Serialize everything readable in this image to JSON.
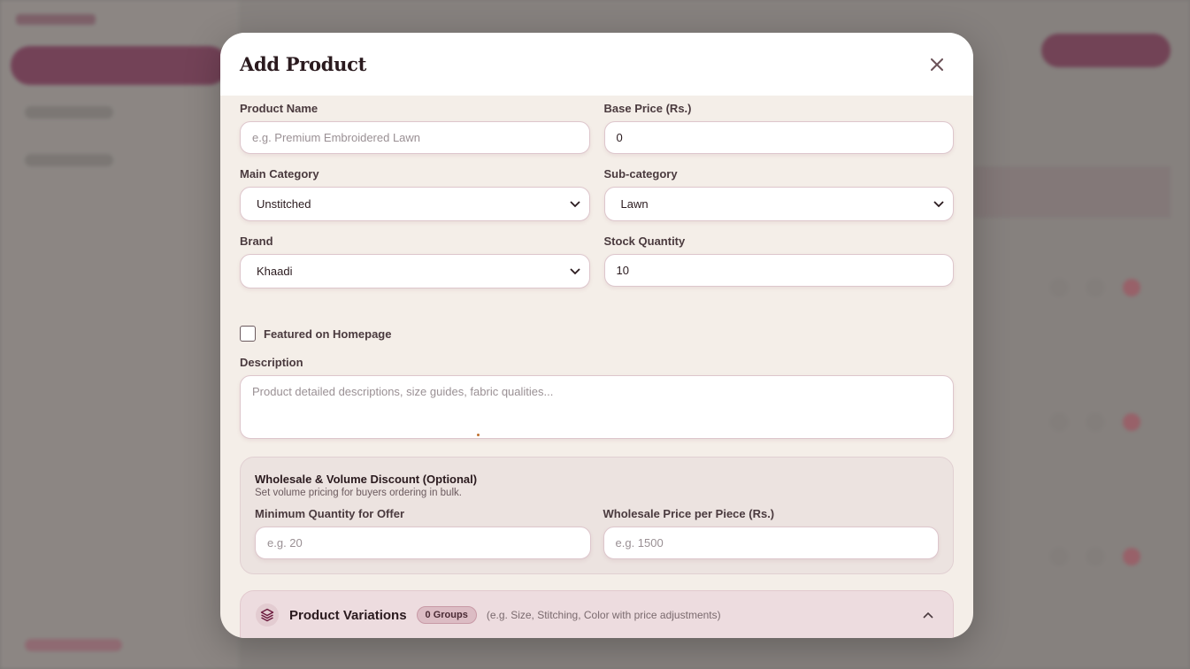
{
  "modal": {
    "title": "Add Product",
    "close_icon": "close-icon"
  },
  "form": {
    "product_name": {
      "label": "Product Name",
      "placeholder": "e.g. Premium Embroidered Lawn",
      "value": ""
    },
    "base_price": {
      "label": "Base Price (Rs.)",
      "value": "0"
    },
    "main_category": {
      "label": "Main Category",
      "selected": "Unstitched"
    },
    "sub_category": {
      "label": "Sub-category",
      "selected": "Lawn"
    },
    "brand": {
      "label": "Brand",
      "selected": "Khaadi"
    },
    "stock_quantity": {
      "label": "Stock Quantity",
      "value": "10"
    },
    "featured": {
      "label": "Featured on Homepage",
      "checked": false
    },
    "description": {
      "label": "Description",
      "placeholder": "Product detailed descriptions, size guides, fabric qualities..."
    }
  },
  "wholesale": {
    "title": "Wholesale & Volume Discount (Optional)",
    "subtitle": "Set volume pricing for buyers ordering in bulk.",
    "min_qty": {
      "label": "Minimum Quantity for Offer",
      "placeholder": "e.g. 20"
    },
    "price": {
      "label": "Wholesale Price per Piece (Rs.)",
      "placeholder": "e.g. 1500"
    }
  },
  "variations": {
    "title": "Product Variations",
    "badge": "0 Groups",
    "hint": "(e.g. Size, Stitching, Color with price adjustments)",
    "icon": "layers-icon",
    "toggle_icon": "chevron-up-icon"
  },
  "colors": {
    "accent": "#6b1a3d",
    "modal_bg": "#f4eee8"
  }
}
